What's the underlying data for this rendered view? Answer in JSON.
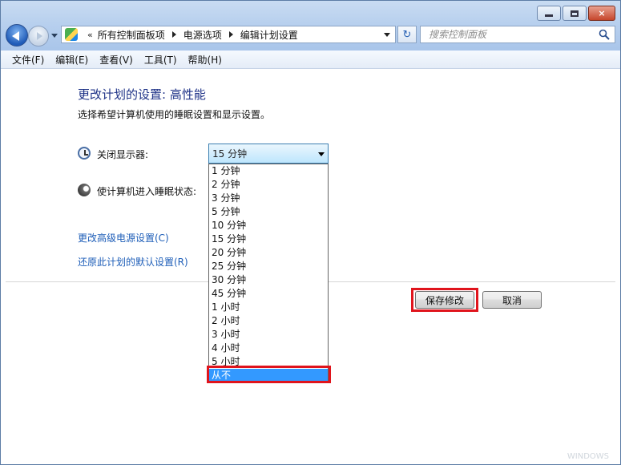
{
  "window": {
    "caption_buttons": {
      "minimize": "minimize",
      "maximize": "maximize",
      "close": "×"
    }
  },
  "address_bar": {
    "prefix": "«",
    "crumbs": [
      "所有控制面板项",
      "电源选项",
      "编辑计划设置"
    ],
    "refresh_glyph": "↻"
  },
  "search": {
    "placeholder": "搜索控制面板"
  },
  "menu": [
    "文件(F)",
    "编辑(E)",
    "查看(V)",
    "工具(T)",
    "帮助(H)"
  ],
  "page": {
    "title": "更改计划的设置: 高性能",
    "subtitle": "选择希望计算机使用的睡眠设置和显示设置。",
    "display_off_label": "关闭显示器:",
    "sleep_label": "使计算机进入睡眠状态:",
    "display_off_value": "15 分钟",
    "dropdown_options": [
      "1 分钟",
      "2 分钟",
      "3 分钟",
      "5 分钟",
      "10 分钟",
      "15 分钟",
      "20 分钟",
      "25 分钟",
      "30 分钟",
      "45 分钟",
      "1 小时",
      "2 小时",
      "3 小时",
      "4 小时",
      "5 小时",
      "从不"
    ],
    "selected_option": "从不",
    "link_advanced": "更改高级电源设置(C)",
    "link_restore": "还原此计划的默认设置(R)",
    "save_button": "保存修改",
    "cancel_button": "取消"
  },
  "watermark": "WINDOWS"
}
